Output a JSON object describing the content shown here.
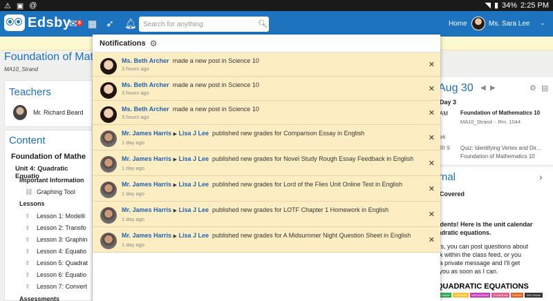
{
  "status_bar": {
    "battery": "34%",
    "time": "2:25 PM"
  },
  "header": {
    "app_name": "Edsby",
    "message_badge": "8",
    "search_placeholder": "Search for anything",
    "home_label": "Home",
    "user_name": "Ms. Sara Lee"
  },
  "course": {
    "title": "Foundation of Mathe",
    "subtitle": "MA10_Strand"
  },
  "teachers": {
    "heading": "Teachers",
    "teacher_name": "Mr. Richard Beard"
  },
  "content": {
    "heading": "Content",
    "course_name": "Foundation of Mathe",
    "unit": "Unit 4: Quadratic Equatio",
    "important_info": "Important Information",
    "graphing_tool": "Graphing Tool",
    "lessons_label": "Lessons",
    "lessons": [
      "Lesson 1: Modelli",
      "Lesson 2: Transfo",
      "Lesson 3: Graphin",
      "Lesson 4: Equatio",
      "Lesson 5: Quadrat",
      "Lesson 6: Equatio",
      "Lesson 7: Convert"
    ],
    "assessments": "Assessments"
  },
  "calendar": {
    "date": "Aug 30",
    "day": "Day 3",
    "event_time": "AM",
    "event_title": "Foundation of Mathematics 10",
    "event_location": "MA10_Strand",
    "event_room": "Rm. 1044",
    "week_label": "ek",
    "quiz_time": "RI 9",
    "quiz_title": "Quiz: Identifying Vertex and Dir...",
    "quiz_course": "Foundation of Mathematics 10"
  },
  "journal": {
    "heading": "rnal",
    "covered": "Covered",
    "line1": "tudents! Here is the unit calendar",
    "line2": "uadratic equations.",
    "line3": "ays, you can post questions about",
    "line4": "ork within the class feed, or you",
    "line5": "n a private message and I'll get",
    "line6": "o you as soon as I can.",
    "banner": "QUADRATIC EQUATIONS",
    "days": [
      "MONDAY",
      "TUESDAY",
      "WEDNESDAY",
      "THURSDAY",
      "FRIDAY",
      "SATURDAY"
    ]
  },
  "notifications": {
    "title": "Notifications",
    "items": [
      {
        "actor": "Ms. Beth Archer",
        "target": "",
        "action": "made a new post",
        "prep": "in",
        "place": "Science 10",
        "time": "3 hours ago",
        "avatar": "f"
      },
      {
        "actor": "Ms. Beth Archer",
        "target": "",
        "action": "made a new post",
        "prep": "in",
        "place": "Science 10",
        "time": "3 hours ago",
        "avatar": "f"
      },
      {
        "actor": "Ms. Beth Archer",
        "target": "",
        "action": "made a new post",
        "prep": "in",
        "place": "Science 10",
        "time": "3 hours ago",
        "avatar": "f"
      },
      {
        "actor": "Mr. James Harris",
        "target": "Lisa J Lee",
        "action": "published new grades for Comparison Essay",
        "prep": "in",
        "place": "English",
        "time": "1 day ago",
        "avatar": "m"
      },
      {
        "actor": "Mr. James Harris",
        "target": "Lisa J Lee",
        "action": "published new grades for Novel Study Rough Essay Feedback",
        "prep": "in",
        "place": "English",
        "time": "1 day ago",
        "avatar": "m"
      },
      {
        "actor": "Mr. James Harris",
        "target": "Lisa J Lee",
        "action": "published new grades for Lord of the Flies Unit Online Test",
        "prep": "in",
        "place": "English",
        "time": "1 day ago",
        "avatar": "m"
      },
      {
        "actor": "Mr. James Harris",
        "target": "Lisa J Lee",
        "action": "published new grades for LOTF Chapter 1 Homework",
        "prep": "in",
        "place": "English",
        "time": "1 day ago",
        "avatar": "m"
      },
      {
        "actor": "Mr. James Harris",
        "target": "Lisa J Lee",
        "action": "published new grades for A Midsummer Night Question Sheet",
        "prep": "in",
        "place": "English",
        "time": "1 day ago",
        "avatar": "m"
      }
    ]
  }
}
